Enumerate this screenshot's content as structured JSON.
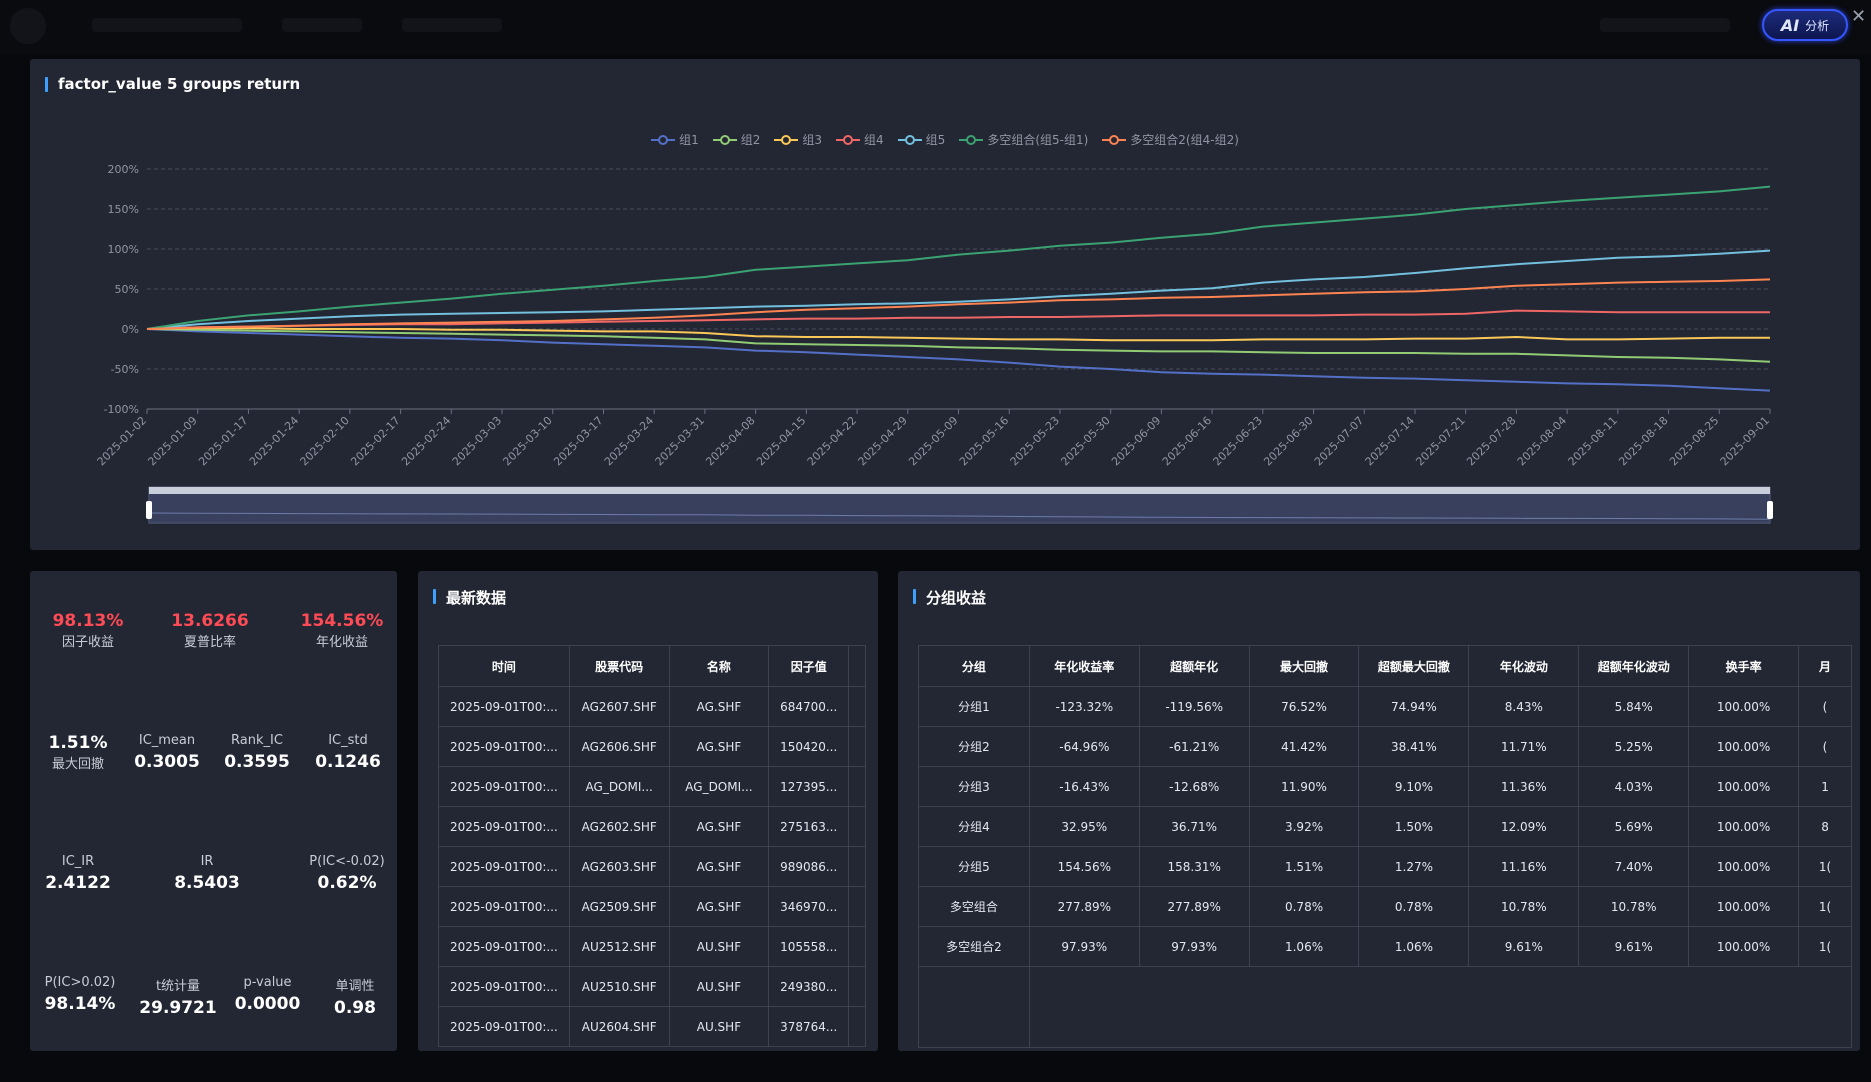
{
  "header": {
    "ai_button": {
      "icon": "AI",
      "label": "分析"
    },
    "close": "✕"
  },
  "chart_panel": {
    "title": "factor_value 5 groups return",
    "chart_data": {
      "type": "line",
      "ylim": [
        -100,
        200
      ],
      "yticks": [
        "200%",
        "150%",
        "100%",
        "50%",
        "0%",
        "-50%",
        "-100%"
      ],
      "ytick_values": [
        200,
        150,
        100,
        50,
        0,
        -50,
        -100
      ],
      "xticks": [
        "2025-01-02",
        "2025-01-09",
        "2025-01-17",
        "2025-01-24",
        "2025-02-10",
        "2025-02-17",
        "2025-02-24",
        "2025-03-03",
        "2025-03-10",
        "2025-03-17",
        "2025-03-24",
        "2025-03-31",
        "2025-04-08",
        "2025-04-15",
        "2025-04-22",
        "2025-04-29",
        "2025-05-09",
        "2025-05-16",
        "2025-05-23",
        "2025-05-30",
        "2025-06-09",
        "2025-06-16",
        "2025-06-23",
        "2025-06-30",
        "2025-07-07",
        "2025-07-14",
        "2025-07-21",
        "2025-07-28",
        "2025-08-04",
        "2025-08-11",
        "2025-08-18",
        "2025-08-25",
        "2025-09-01"
      ],
      "grid": true,
      "legend_position": "top-center",
      "series": [
        {
          "name": "组1",
          "color": "#5470c6",
          "values": [
            0,
            -3,
            -5,
            -7,
            -9,
            -11,
            -12,
            -14,
            -17,
            -19,
            -21,
            -23,
            -27,
            -29,
            -32,
            -35,
            -38,
            -42,
            -47,
            -50,
            -54,
            -56,
            -57,
            -59,
            -61,
            -62,
            -64,
            -66,
            -68,
            -69,
            -71,
            -74,
            -77
          ]
        },
        {
          "name": "组2",
          "color": "#91cc75",
          "values": [
            0,
            -1,
            -2,
            -3,
            -4,
            -5,
            -6,
            -7,
            -8,
            -9,
            -11,
            -13,
            -18,
            -19,
            -20,
            -21,
            -23,
            -24,
            -26,
            -27,
            -28,
            -28,
            -29,
            -30,
            -30,
            -30,
            -31,
            -31,
            -33,
            -35,
            -36,
            -38,
            -41
          ]
        },
        {
          "name": "组3",
          "color": "#fac858",
          "values": [
            0,
            1,
            1,
            0,
            0,
            0,
            -1,
            -1,
            -2,
            -3,
            -3,
            -5,
            -9,
            -10,
            -10,
            -11,
            -12,
            -13,
            -13,
            -14,
            -14,
            -14,
            -13,
            -13,
            -13,
            -12,
            -12,
            -10,
            -13,
            -13,
            -12,
            -11,
            -11
          ]
        },
        {
          "name": "组4",
          "color": "#ee6666",
          "values": [
            0,
            2,
            3,
            4,
            5,
            6,
            6,
            7,
            8,
            9,
            10,
            11,
            12,
            13,
            13,
            14,
            14,
            15,
            15,
            16,
            17,
            17,
            17,
            17,
            18,
            18,
            19,
            23,
            22,
            21,
            21,
            21,
            21
          ]
        },
        {
          "name": "组5",
          "color": "#73c0de",
          "values": [
            0,
            6,
            10,
            13,
            16,
            18,
            19,
            20,
            21,
            22,
            24,
            26,
            28,
            29,
            31,
            32,
            34,
            37,
            41,
            44,
            48,
            51,
            58,
            62,
            65,
            70,
            76,
            81,
            85,
            89,
            91,
            94,
            98
          ]
        },
        {
          "name": "多空组合(组5-组1)",
          "color": "#3ba272",
          "values": [
            0,
            10,
            17,
            22,
            28,
            33,
            38,
            44,
            49,
            54,
            60,
            65,
            74,
            78,
            82,
            86,
            93,
            98,
            104,
            108,
            114,
            119,
            128,
            133,
            138,
            143,
            150,
            155,
            160,
            164,
            168,
            172,
            178
          ]
        },
        {
          "name": "多空组合2(组4-组2)",
          "color": "#fc8452",
          "values": [
            0,
            2,
            3,
            4,
            6,
            7,
            8,
            9,
            10,
            12,
            14,
            17,
            21,
            24,
            26,
            28,
            31,
            33,
            36,
            37,
            39,
            40,
            42,
            44,
            46,
            47,
            50,
            54,
            56,
            58,
            59,
            60,
            62
          ]
        }
      ]
    }
  },
  "stats_panel": {
    "factor_return": {
      "value": "98.13%",
      "label": "因子收益"
    },
    "sharpe": {
      "value": "13.6266",
      "label": "夏普比率"
    },
    "annual_return": {
      "value": "154.56%",
      "label": "年化收益"
    },
    "max_drawdown": {
      "value": "1.51%",
      "label": "最大回撤"
    },
    "ic_mean": {
      "value": "0.3005",
      "label": "IC_mean"
    },
    "rank_ic": {
      "value": "0.3595",
      "label": "Rank_IC"
    },
    "ic_std": {
      "value": "0.1246",
      "label": "IC_std"
    },
    "ic_ir": {
      "value": "2.4122",
      "label": "IC_IR"
    },
    "ir": {
      "value": "8.5403",
      "label": "IR"
    },
    "p_ic_neg": {
      "value": "0.62%",
      "label": "P(IC<-0.02)"
    },
    "p_ic_pos": {
      "value": "98.14%",
      "label": "P(IC>0.02)"
    },
    "t_stat": {
      "value": "29.9721",
      "label": "t统计量"
    },
    "p_value": {
      "value": "0.0000",
      "label": "p-value"
    },
    "monotonic": {
      "value": "0.98",
      "label": "单调性"
    }
  },
  "latest_panel": {
    "title": "最新数据",
    "headers": [
      "时间",
      "股票代码",
      "名称",
      "因子值"
    ],
    "rows": [
      [
        "2025-09-01T00:...",
        "AG2607.SHF",
        "AG.SHF",
        "684700..."
      ],
      [
        "2025-09-01T00:...",
        "AG2606.SHF",
        "AG.SHF",
        "150420..."
      ],
      [
        "2025-09-01T00:...",
        "AG_DOMI...",
        "AG_DOMI...",
        "127395..."
      ],
      [
        "2025-09-01T00:...",
        "AG2602.SHF",
        "AG.SHF",
        "275163..."
      ],
      [
        "2025-09-01T00:...",
        "AG2603.SHF",
        "AG.SHF",
        "989086..."
      ],
      [
        "2025-09-01T00:...",
        "AG2509.SHF",
        "AG.SHF",
        "346970..."
      ],
      [
        "2025-09-01T00:...",
        "AU2512.SHF",
        "AU.SHF",
        "105558..."
      ],
      [
        "2025-09-01T00:...",
        "AU2510.SHF",
        "AU.SHF",
        "249380..."
      ],
      [
        "2025-09-01T00:...",
        "AU2604.SHF",
        "AU.SHF",
        "378764..."
      ]
    ]
  },
  "group_panel": {
    "title": "分组收益",
    "headers": [
      "分组",
      "年化收益率",
      "超额年化",
      "最大回撤",
      "超额最大回撤",
      "年化波动",
      "超额年化波动",
      "换手率",
      "月"
    ],
    "rows": [
      [
        "分组1",
        "-123.32%",
        "-119.56%",
        "76.52%",
        "74.94%",
        "8.43%",
        "5.84%",
        "100.00%",
        "("
      ],
      [
        "分组2",
        "-64.96%",
        "-61.21%",
        "41.42%",
        "38.41%",
        "11.71%",
        "5.25%",
        "100.00%",
        "("
      ],
      [
        "分组3",
        "-16.43%",
        "-12.68%",
        "11.90%",
        "9.10%",
        "11.36%",
        "4.03%",
        "100.00%",
        "1"
      ],
      [
        "分组4",
        "32.95%",
        "36.71%",
        "3.92%",
        "1.50%",
        "12.09%",
        "5.69%",
        "100.00%",
        "8"
      ],
      [
        "分组5",
        "154.56%",
        "158.31%",
        "1.51%",
        "1.27%",
        "11.16%",
        "7.40%",
        "100.00%",
        "1("
      ],
      [
        "多空组合",
        "277.89%",
        "277.89%",
        "0.78%",
        "0.78%",
        "10.78%",
        "10.78%",
        "100.00%",
        "1("
      ],
      [
        "多空组合2",
        "97.93%",
        "97.93%",
        "1.06%",
        "1.06%",
        "9.61%",
        "9.61%",
        "100.00%",
        "1("
      ]
    ]
  }
}
